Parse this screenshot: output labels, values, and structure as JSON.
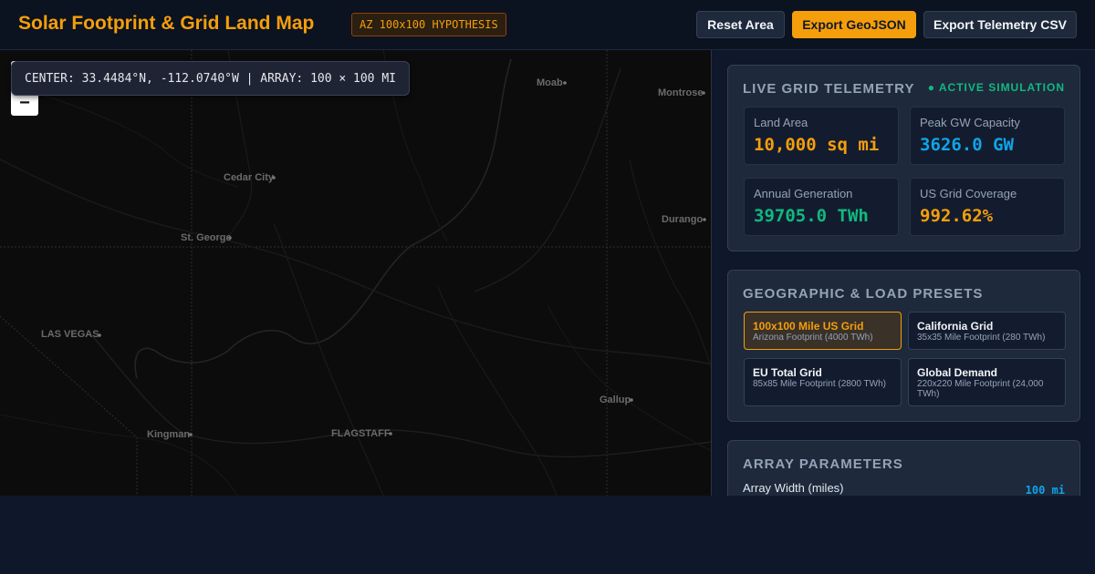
{
  "header": {
    "title": "Solar Footprint & Grid Land Map",
    "badge": "AZ 100x100 HYPOTHESIS",
    "buttons": {
      "reset": "Reset Area",
      "export_geojson": "Export GeoJSON",
      "export_csv": "Export Telemetry CSV"
    }
  },
  "map": {
    "coord_readout": "CENTER: 33.4484°N, -112.0740°W | ARRAY: 100 × 100 MI",
    "zoom_out": "−",
    "cities": [
      "Moab",
      "Montrose",
      "Cedar City",
      "St. George",
      "Durango",
      "LAS VEGAS",
      "Gallup",
      "Kingman",
      "FLAGSTAFF"
    ]
  },
  "telemetry": {
    "title": "LIVE GRID TELEMETRY",
    "status": "● ACTIVE SIMULATION",
    "stats": [
      {
        "label": "Land Area",
        "value": "10,000 sq mi",
        "color": "#f59e0b"
      },
      {
        "label": "Peak GW Capacity",
        "value": "3626.0 GW",
        "color": "#0ea5e9"
      },
      {
        "label": "Annual Generation",
        "value": "39705.0 TWh",
        "color": "#10b981"
      },
      {
        "label": "US Grid Coverage",
        "value": "992.62%",
        "color": "#f59e0b"
      }
    ]
  },
  "presets": {
    "title": "GEOGRAPHIC & LOAD PRESETS",
    "items": [
      {
        "name": "100x100 Mile US Grid",
        "desc": "Arizona Footprint (4000 TWh)",
        "active": true
      },
      {
        "name": "California Grid",
        "desc": "35x35 Mile Footprint (280 TWh)",
        "active": false
      },
      {
        "name": "EU Total Grid",
        "desc": "85x85 Mile Footprint (2800 TWh)",
        "active": false
      },
      {
        "name": "Global Demand",
        "desc": "220x220 Mile Footprint (24,000 TWh)",
        "active": false
      }
    ]
  },
  "parameters": {
    "title": "ARRAY PARAMETERS",
    "width_label": "Array Width (miles)",
    "width_value": "100 mi"
  },
  "colors": {
    "accent": "#f59e0b",
    "blue": "#0ea5e9",
    "green": "#10b981",
    "bg": "#0f172a"
  }
}
